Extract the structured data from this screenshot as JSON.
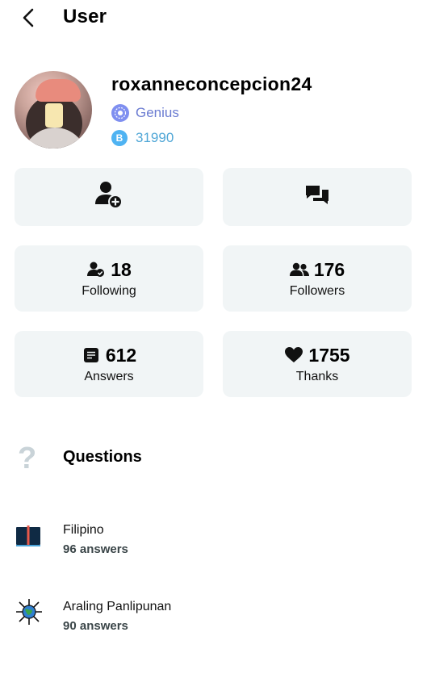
{
  "header": {
    "title": "User",
    "back_icon": "chevron-left-icon"
  },
  "profile": {
    "username": "roxanneconcepcion24",
    "rank": {
      "label": "Genius",
      "icon": "genius-rank-icon",
      "color": "#6a7bd1"
    },
    "points": {
      "value": "31990",
      "icon_letter": "B",
      "color": "#4fa6d6"
    }
  },
  "actions": [
    {
      "icon": "add-friend-icon"
    },
    {
      "icon": "messages-icon"
    }
  ],
  "stats": [
    {
      "value": "18",
      "label": "Following",
      "icon": "user-check-icon"
    },
    {
      "value": "176",
      "label": "Followers",
      "icon": "users-icon"
    },
    {
      "value": "612",
      "label": "Answers",
      "icon": "document-icon"
    },
    {
      "value": "1755",
      "label": "Thanks",
      "icon": "heart-icon"
    }
  ],
  "questions": {
    "title": "Questions",
    "icon": "question-mark-icon"
  },
  "subjects": [
    {
      "name": "Filipino",
      "count": "96 answers",
      "icon": "book-icon"
    },
    {
      "name": "Araling Panlipunan",
      "count": "90 answers",
      "icon": "globe-icon"
    }
  ]
}
